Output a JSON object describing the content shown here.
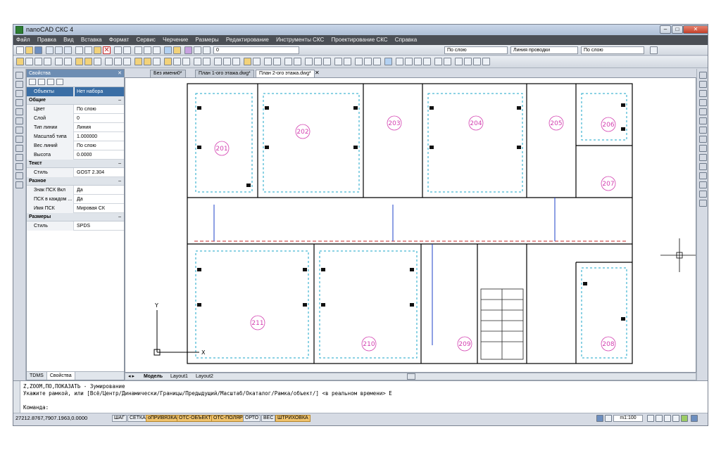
{
  "window": {
    "title": "nanoCAD СКС 4"
  },
  "menu": [
    "Файл",
    "Правка",
    "Вид",
    "Вставка",
    "Формат",
    "Сервис",
    "Черчение",
    "Размеры",
    "Редактирование",
    "Инструменты СКС",
    "Проектирование СКС",
    "Справка"
  ],
  "toolbar": {
    "layer_value": "0",
    "color_value": "По слою",
    "linetype_value": "Линия проводки",
    "lineweight_value": "По слою"
  },
  "properties_panel": {
    "title": "Свойства",
    "selector_label": "Объекты",
    "selector_value": "Нет набора",
    "sections": [
      {
        "name": "Общие",
        "rows": [
          {
            "key": "Цвет",
            "value": "По слою"
          },
          {
            "key": "Слой",
            "value": "0"
          },
          {
            "key": "Тип линии",
            "value": "Линия"
          },
          {
            "key": "Масштаб типа",
            "value": "1.000000"
          },
          {
            "key": "Вес линий",
            "value": "По слою"
          },
          {
            "key": "Высота",
            "value": "0.0000"
          }
        ]
      },
      {
        "name": "Текст",
        "rows": [
          {
            "key": "Стиль",
            "value": "GOST 2.304"
          }
        ]
      },
      {
        "name": "Разное",
        "rows": [
          {
            "key": "Знак ПСК Вкл",
            "value": "Да"
          },
          {
            "key": "ПСК в каждом ...",
            "value": "Да"
          },
          {
            "key": "Имя ПСК",
            "value": "Мировая СК"
          }
        ]
      },
      {
        "name": "Размеры",
        "rows": [
          {
            "key": "Стиль",
            "value": "SPDS"
          }
        ]
      }
    ],
    "tabs": [
      "TDMS",
      "Свойства"
    ]
  },
  "doc_tabs": [
    "Без имени0*",
    "План 1-ого этажа.dwg*",
    "План 2-ого этажа.dwg*"
  ],
  "layout_tabs": [
    "Модель",
    "Layout1",
    "Layout2"
  ],
  "rooms": [
    "201",
    "202",
    "203",
    "204",
    "205",
    "206",
    "207",
    "211",
    "210",
    "209",
    "208"
  ],
  "command": {
    "line1": "Z,ZOOM,ПО,ПОКАЗАТЬ - Зумирование",
    "line2": "Укажите рамкой, или [Всё/Центр/Динамически/Границы/Предыдущий/Масштаб/Окаталог/Рамка/объект/] <в реальном времени> Е",
    "prompt": "Команда:"
  },
  "status": {
    "coords": "27212.8767,7907.1963,0.0000",
    "buttons": [
      {
        "label": "ШАГ",
        "on": false
      },
      {
        "label": "СЕТКА",
        "on": false
      },
      {
        "label": "оПРИВЯЗКА",
        "on": true
      },
      {
        "label": "ОТС-ОБЪЕКТ",
        "on": true
      },
      {
        "label": "ОТС-ПОЛЯР",
        "on": true
      },
      {
        "label": "ОРТО",
        "on": false
      },
      {
        "label": "ВЕС",
        "on": false
      },
      {
        "label": "ШТРИХОВКА",
        "on": true
      }
    ],
    "scale": "m1:100"
  },
  "colors": {
    "menu_bg": "#4b4f55",
    "panel_header": "#6d8db3",
    "cable": "#1aa6c9",
    "room_label": "#d33fb0",
    "status_on": "#f0c36d"
  }
}
